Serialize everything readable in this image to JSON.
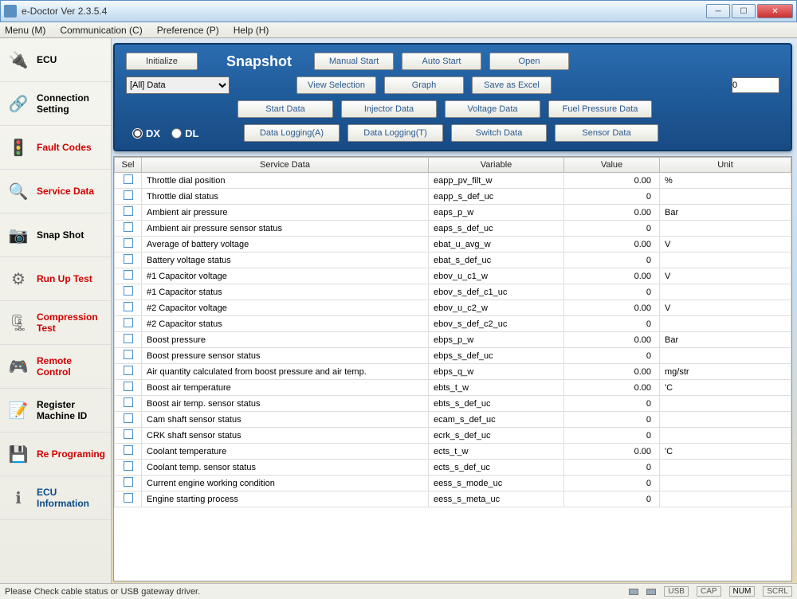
{
  "window": {
    "title": "e-Doctor Ver 2.3.5.4"
  },
  "menu": {
    "items": [
      "Menu (M)",
      "Communication (C)",
      "Preference (P)",
      "Help (H)"
    ]
  },
  "sidebar": {
    "items": [
      {
        "label": "ECU",
        "color": "black",
        "icon": "🔌"
      },
      {
        "label": "Connection Setting",
        "color": "black",
        "icon": "🔗"
      },
      {
        "label": "Fault Codes",
        "color": "red",
        "icon": "🚦"
      },
      {
        "label": "Service Data",
        "color": "red",
        "icon": "🔍"
      },
      {
        "label": "Snap Shot",
        "color": "black",
        "icon": "📷"
      },
      {
        "label": "Run Up Test",
        "color": "red",
        "icon": "⚙"
      },
      {
        "label": "Compression Test",
        "color": "red",
        "icon": "🗜"
      },
      {
        "label": "Remote Control",
        "color": "red",
        "icon": "🎮"
      },
      {
        "label": "Register Machine ID",
        "color": "black",
        "icon": "📝"
      },
      {
        "label": "Re Programing",
        "color": "red",
        "icon": "💾"
      },
      {
        "label": "ECU Information",
        "color": "blue",
        "icon": "ℹ"
      }
    ]
  },
  "panel": {
    "initialize": "Initialize",
    "data_select": "[All] Data",
    "snapshot_title": "Snapshot",
    "manual_start": "Manual Start",
    "auto_start": "Auto Start",
    "open": "Open",
    "view_selection": "View Selection",
    "graph": "Graph",
    "save_excel": "Save as Excel",
    "spinner_value": "0",
    "radio_dx": "DX",
    "radio_dl": "DL",
    "start_data": "Start Data",
    "injector_data": "Injector Data",
    "voltage_data": "Voltage Data",
    "fuel_pressure": "Fuel Pressure Data",
    "data_logging_a": "Data Logging(A)",
    "data_logging_t": "Data Logging(T)",
    "switch_data": "Switch Data",
    "sensor_data": "Sensor Data"
  },
  "table": {
    "headers": {
      "sel": "Sel",
      "service": "Service Data",
      "variable": "Variable",
      "value": "Value",
      "unit": "Unit"
    },
    "rows": [
      {
        "service": "Throttle dial position",
        "variable": "eapp_pv_filt_w",
        "value": "0.00",
        "unit": "%"
      },
      {
        "service": "Throttle dial status",
        "variable": "eapp_s_def_uc",
        "value": "0",
        "unit": ""
      },
      {
        "service": "Ambient air pressure",
        "variable": "eaps_p_w",
        "value": "0.00",
        "unit": "Bar"
      },
      {
        "service": "Ambient air pressure sensor status",
        "variable": "eaps_s_def_uc",
        "value": "0",
        "unit": ""
      },
      {
        "service": "Average of battery voltage",
        "variable": "ebat_u_avg_w",
        "value": "0.00",
        "unit": "V"
      },
      {
        "service": "Battery voltage status",
        "variable": "ebat_s_def_uc",
        "value": "0",
        "unit": ""
      },
      {
        "service": "#1 Capacitor voltage",
        "variable": "ebov_u_c1_w",
        "value": "0.00",
        "unit": "V"
      },
      {
        "service": "#1 Capacitor status",
        "variable": "ebov_s_def_c1_uc",
        "value": "0",
        "unit": ""
      },
      {
        "service": "#2 Capacitor voltage",
        "variable": "ebov_u_c2_w",
        "value": "0.00",
        "unit": "V"
      },
      {
        "service": "#2 Capacitor status",
        "variable": "ebov_s_def_c2_uc",
        "value": "0",
        "unit": ""
      },
      {
        "service": "Boost pressure",
        "variable": "ebps_p_w",
        "value": "0.00",
        "unit": "Bar"
      },
      {
        "service": "Boost pressure sensor status",
        "variable": "ebps_s_def_uc",
        "value": "0",
        "unit": ""
      },
      {
        "service": "Air quantity calculated from boost pressure and air temp.",
        "variable": "ebps_q_w",
        "value": "0.00",
        "unit": "mg/str"
      },
      {
        "service": "Boost air temperature",
        "variable": "ebts_t_w",
        "value": "0.00",
        "unit": "'C"
      },
      {
        "service": "Boost air temp. sensor status",
        "variable": "ebts_s_def_uc",
        "value": "0",
        "unit": ""
      },
      {
        "service": "Cam shaft sensor status",
        "variable": "ecam_s_def_uc",
        "value": "0",
        "unit": ""
      },
      {
        "service": "CRK shaft sensor status",
        "variable": "ecrk_s_def_uc",
        "value": "0",
        "unit": ""
      },
      {
        "service": "Coolant temperature",
        "variable": "ects_t_w",
        "value": "0.00",
        "unit": "'C"
      },
      {
        "service": "Coolant temp. sensor status",
        "variable": "ects_s_def_uc",
        "value": "0",
        "unit": ""
      },
      {
        "service": "Current engine working condition",
        "variable": "eess_s_mode_uc",
        "value": "0",
        "unit": ""
      },
      {
        "service": "Engine starting process",
        "variable": "eess_s_meta_uc",
        "value": "0",
        "unit": ""
      }
    ]
  },
  "status": {
    "text": "Please Check cable status or USB gateway driver.",
    "usb": "USB",
    "cap": "CAP",
    "num": "NUM",
    "scrl": "SCRL"
  }
}
